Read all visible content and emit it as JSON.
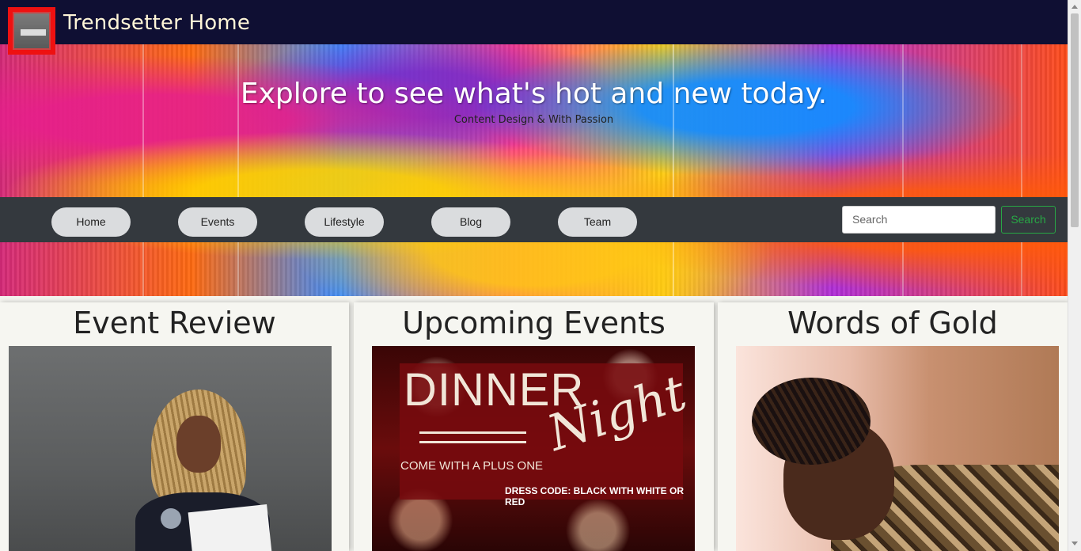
{
  "header": {
    "brand": "Trendsetter Home"
  },
  "hero": {
    "title": "Explore to see what's hot and new today.",
    "subtitle": "Content Design & With Passion"
  },
  "nav": {
    "items": [
      {
        "label": "Home"
      },
      {
        "label": "Events"
      },
      {
        "label": "Lifestyle"
      },
      {
        "label": "Blog"
      },
      {
        "label": "Team"
      }
    ],
    "search_placeholder": "Search",
    "search_button": "Search"
  },
  "cards": [
    {
      "title": "Event Review"
    },
    {
      "title": "Upcoming Events",
      "poster": {
        "headline": "DINNER",
        "script": "Night",
        "tagline": "COME WITH A PLUS ONE",
        "dress_code": "DRESS CODE:  BLACK WITH WHITE OR RED"
      }
    },
    {
      "title": "Words of Gold"
    }
  ],
  "colors": {
    "topbar": "#0f0f33",
    "navbar": "#34393e",
    "search_button": "#28a745",
    "logo": "#ee1111"
  }
}
